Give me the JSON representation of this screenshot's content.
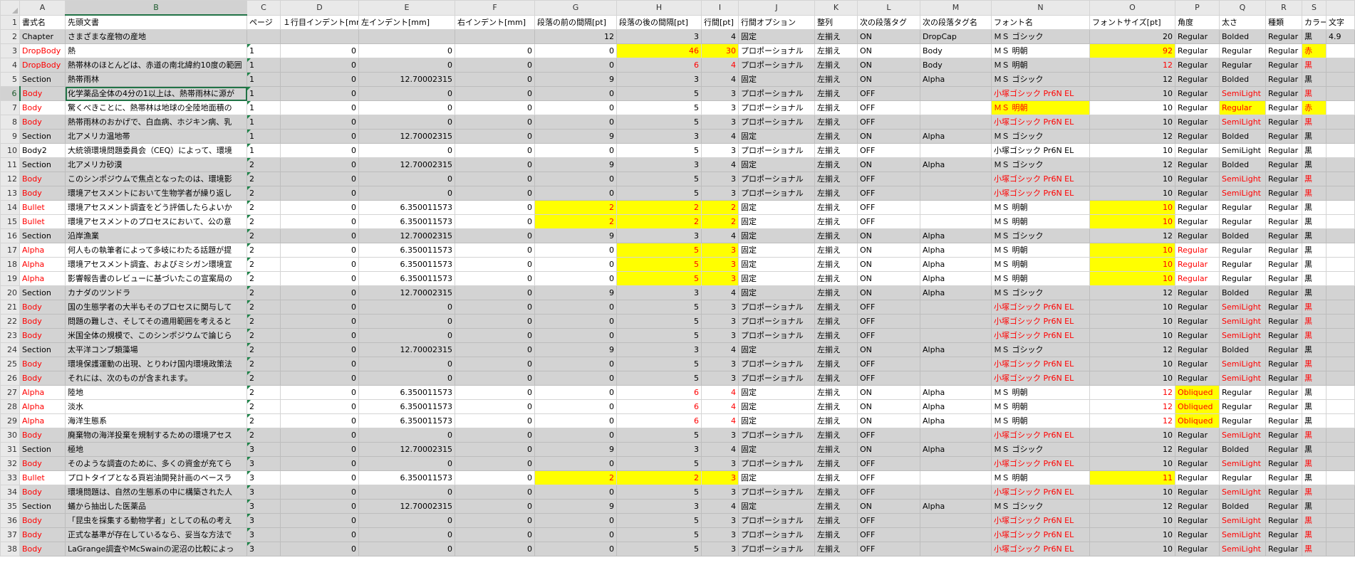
{
  "sheet": {
    "column_letters": [
      "A",
      "B",
      "C",
      "D",
      "E",
      "F",
      "G",
      "H",
      "I",
      "J",
      "K",
      "L",
      "M",
      "N",
      "O",
      "P",
      "Q",
      "R",
      "S",
      ""
    ],
    "selected_column": "B",
    "selected_row": 6,
    "header_row": [
      "書式名",
      "先頭文書",
      "ページ",
      "１行目インデント[mm]",
      "左インデント[mm]",
      "右インデント[mm]",
      "段落の前の間隔[pt]",
      "段落の後の間隔[pt]",
      "行間[pt]",
      "行間オプション",
      "整列",
      "次の段落タグ",
      "次の段落タグ名",
      "フォント名",
      "フォントサイズ[pt]",
      "角度",
      "太さ",
      "種類",
      "カラー",
      "文字"
    ],
    "rows": [
      {
        "num": "2",
        "c": [
          "Chapter",
          "さまざまな産物の産地",
          "",
          "",
          "",
          "",
          "12",
          "3",
          "4",
          "固定",
          "左揃え",
          "ON",
          "DropCap",
          "ＭＳ ゴシック",
          "20",
          "Regular",
          "Bolded",
          "Regular",
          "黒",
          "4.9"
        ]
      },
      {
        "num": "3",
        "c": [
          "DropBody",
          "熱",
          "1",
          "0",
          "0",
          "0",
          "0",
          "46",
          "30",
          "プロポーショナル",
          "左揃え",
          "ON",
          "Body",
          "ＭＳ 明朝",
          "92",
          "Regular",
          "Regular",
          "Regular",
          "赤",
          ""
        ]
      },
      {
        "num": "4",
        "c": [
          "DropBody",
          "熱帯林のほとんどは、赤道の南北緯約10度の範囲",
          "1",
          "0",
          "0",
          "0",
          "0",
          "6",
          "4",
          "プロポーショナル",
          "左揃え",
          "ON",
          "Body",
          "ＭＳ 明朝",
          "12",
          "Regular",
          "Regular",
          "Regular",
          "黒",
          ""
        ]
      },
      {
        "num": "5",
        "c": [
          "Section",
          "熱帯雨林",
          "1",
          "0",
          "12.70002315",
          "0",
          "9",
          "3",
          "4",
          "固定",
          "左揃え",
          "ON",
          "Alpha",
          "ＭＳ ゴシック",
          "12",
          "Regular",
          "Bolded",
          "Regular",
          "黒",
          ""
        ]
      },
      {
        "num": "6",
        "c": [
          "Body",
          "化学薬品全体の4分の1以上は、熱帯雨林に源が",
          "1",
          "0",
          "0",
          "0",
          "0",
          "5",
          "3",
          "プロポーショナル",
          "左揃え",
          "OFF",
          "",
          "小塚ゴシック Pr6N EL",
          "10",
          "Regular",
          "SemiLight",
          "Regular",
          "黒",
          ""
        ]
      },
      {
        "num": "7",
        "c": [
          "Body",
          "驚くべきことに、熱帯林は地球の全陸地面積の",
          "1",
          "0",
          "0",
          "0",
          "0",
          "5",
          "3",
          "プロポーショナル",
          "左揃え",
          "OFF",
          "",
          "ＭＳ 明朝",
          "10",
          "Regular",
          "Regular",
          "Regular",
          "赤",
          ""
        ]
      },
      {
        "num": "8",
        "c": [
          "Body",
          "熱帯雨林のおかげで、白血病、ホジキン病、乳",
          "1",
          "0",
          "0",
          "0",
          "0",
          "5",
          "3",
          "プロポーショナル",
          "左揃え",
          "OFF",
          "",
          "小塚ゴシック Pr6N EL",
          "10",
          "Regular",
          "SemiLight",
          "Regular",
          "黒",
          ""
        ]
      },
      {
        "num": "9",
        "c": [
          "Section",
          "北アメリカ温地帯",
          "1",
          "0",
          "12.70002315",
          "0",
          "9",
          "3",
          "4",
          "固定",
          "左揃え",
          "ON",
          "Alpha",
          "ＭＳ ゴシック",
          "12",
          "Regular",
          "Bolded",
          "Regular",
          "黒",
          ""
        ]
      },
      {
        "num": "10",
        "c": [
          "Body2",
          "大統領環境問題委員会（CEQ）によって、環境",
          "1",
          "0",
          "0",
          "0",
          "0",
          "5",
          "3",
          "プロポーショナル",
          "左揃え",
          "OFF",
          "",
          "小塚ゴシック Pr6N EL",
          "10",
          "Regular",
          "SemiLight",
          "Regular",
          "黒",
          ""
        ]
      },
      {
        "num": "11",
        "c": [
          "Section",
          "北アメリカ砂漠",
          "2",
          "0",
          "12.70002315",
          "0",
          "9",
          "3",
          "4",
          "固定",
          "左揃え",
          "ON",
          "Alpha",
          "ＭＳ ゴシック",
          "12",
          "Regular",
          "Bolded",
          "Regular",
          "黒",
          ""
        ]
      },
      {
        "num": "12",
        "c": [
          "Body",
          "このシンポジウムで焦点となったのは、環境影",
          "2",
          "0",
          "0",
          "0",
          "0",
          "5",
          "3",
          "プロポーショナル",
          "左揃え",
          "OFF",
          "",
          "小塚ゴシック Pr6N EL",
          "10",
          "Regular",
          "SemiLight",
          "Regular",
          "黒",
          ""
        ]
      },
      {
        "num": "13",
        "c": [
          "Body",
          "環境アセスメントにおいて生物学者が繰り返し",
          "2",
          "0",
          "0",
          "0",
          "0",
          "5",
          "3",
          "プロポーショナル",
          "左揃え",
          "OFF",
          "",
          "小塚ゴシック Pr6N EL",
          "10",
          "Regular",
          "SemiLight",
          "Regular",
          "黒",
          ""
        ]
      },
      {
        "num": "14",
        "c": [
          "Bullet",
          "環境アセスメント調査をどう評価したらよいか",
          "2",
          "0",
          "6.350011573",
          "0",
          "2",
          "2",
          "2",
          "固定",
          "左揃え",
          "OFF",
          "",
          "ＭＳ 明朝",
          "10",
          "Regular",
          "Regular",
          "Regular",
          "黒",
          ""
        ]
      },
      {
        "num": "15",
        "c": [
          "Bullet",
          "環境アセスメントのプロセスにおいて、公の意",
          "2",
          "0",
          "6.350011573",
          "0",
          "2",
          "2",
          "2",
          "固定",
          "左揃え",
          "OFF",
          "",
          "ＭＳ 明朝",
          "10",
          "Regular",
          "Regular",
          "Regular",
          "黒",
          ""
        ]
      },
      {
        "num": "16",
        "c": [
          "Section",
          "沿岸漁業",
          "2",
          "0",
          "12.70002315",
          "0",
          "9",
          "3",
          "4",
          "固定",
          "左揃え",
          "ON",
          "Alpha",
          "ＭＳ ゴシック",
          "12",
          "Regular",
          "Bolded",
          "Regular",
          "黒",
          ""
        ]
      },
      {
        "num": "17",
        "c": [
          "Alpha",
          "何人もの執筆者によって多岐にわたる話題が提",
          "2",
          "0",
          "6.350011573",
          "0",
          "0",
          "5",
          "3",
          "固定",
          "左揃え",
          "ON",
          "Alpha",
          "ＭＳ 明朝",
          "10",
          "Regular",
          "Regular",
          "Regular",
          "黒",
          ""
        ]
      },
      {
        "num": "18",
        "c": [
          "Alpha",
          "環境アセスメント調査、およびミシガン環境宣",
          "2",
          "0",
          "6.350011573",
          "0",
          "0",
          "5",
          "3",
          "固定",
          "左揃え",
          "ON",
          "Alpha",
          "ＭＳ 明朝",
          "10",
          "Regular",
          "Regular",
          "Regular",
          "黒",
          ""
        ]
      },
      {
        "num": "19",
        "c": [
          "Alpha",
          "影響報告書のレビューに基づいたこの宣案局の",
          "2",
          "0",
          "6.350011573",
          "0",
          "0",
          "5",
          "3",
          "固定",
          "左揃え",
          "ON",
          "Alpha",
          "ＭＳ 明朝",
          "10",
          "Regular",
          "Regular",
          "Regular",
          "黒",
          ""
        ]
      },
      {
        "num": "20",
        "c": [
          "Section",
          "カナダのツンドラ",
          "2",
          "0",
          "12.70002315",
          "0",
          "9",
          "3",
          "4",
          "固定",
          "左揃え",
          "ON",
          "Alpha",
          "ＭＳ ゴシック",
          "12",
          "Regular",
          "Bolded",
          "Regular",
          "黒",
          ""
        ]
      },
      {
        "num": "21",
        "c": [
          "Body",
          "国の生態学者の大半もそのプロセスに関与して",
          "2",
          "0",
          "0",
          "0",
          "0",
          "5",
          "3",
          "プロポーショナル",
          "左揃え",
          "OFF",
          "",
          "小塚ゴシック Pr6N EL",
          "10",
          "Regular",
          "SemiLight",
          "Regular",
          "黒",
          ""
        ]
      },
      {
        "num": "22",
        "c": [
          "Body",
          "問題の難しさ、そしてその適用範囲を考えると",
          "2",
          "0",
          "0",
          "0",
          "0",
          "5",
          "3",
          "プロポーショナル",
          "左揃え",
          "OFF",
          "",
          "小塚ゴシック Pr6N EL",
          "10",
          "Regular",
          "SemiLight",
          "Regular",
          "黒",
          ""
        ]
      },
      {
        "num": "23",
        "c": [
          "Body",
          "米国全体の規模で、このシンポジウムで論じら",
          "2",
          "0",
          "0",
          "0",
          "0",
          "5",
          "3",
          "プロポーショナル",
          "左揃え",
          "OFF",
          "",
          "小塚ゴシック Pr6N EL",
          "10",
          "Regular",
          "SemiLight",
          "Regular",
          "黒",
          ""
        ]
      },
      {
        "num": "24",
        "c": [
          "Section",
          "太平洋コンブ類藻場",
          "2",
          "0",
          "12.70002315",
          "0",
          "9",
          "3",
          "4",
          "固定",
          "左揃え",
          "ON",
          "Alpha",
          "ＭＳ ゴシック",
          "12",
          "Regular",
          "Bolded",
          "Regular",
          "黒",
          ""
        ]
      },
      {
        "num": "25",
        "c": [
          "Body",
          "環境保護運動の出現、とりわけ国内環境政策法",
          "2",
          "0",
          "0",
          "0",
          "0",
          "5",
          "3",
          "プロポーショナル",
          "左揃え",
          "OFF",
          "",
          "小塚ゴシック Pr6N EL",
          "10",
          "Regular",
          "SemiLight",
          "Regular",
          "黒",
          ""
        ]
      },
      {
        "num": "26",
        "c": [
          "Body",
          "それには、次のものが含まれます。",
          "2",
          "0",
          "0",
          "0",
          "0",
          "5",
          "3",
          "プロポーショナル",
          "左揃え",
          "OFF",
          "",
          "小塚ゴシック Pr6N EL",
          "10",
          "Regular",
          "SemiLight",
          "Regular",
          "黒",
          ""
        ]
      },
      {
        "num": "27",
        "c": [
          "Alpha",
          "陸地",
          "2",
          "0",
          "6.350011573",
          "0",
          "0",
          "6",
          "4",
          "固定",
          "左揃え",
          "ON",
          "Alpha",
          "ＭＳ 明朝",
          "12",
          "Obliqued",
          "Regular",
          "Regular",
          "黒",
          ""
        ]
      },
      {
        "num": "28",
        "c": [
          "Alpha",
          "淡水",
          "2",
          "0",
          "6.350011573",
          "0",
          "0",
          "6",
          "4",
          "固定",
          "左揃え",
          "ON",
          "Alpha",
          "ＭＳ 明朝",
          "12",
          "Obliqued",
          "Regular",
          "Regular",
          "黒",
          ""
        ]
      },
      {
        "num": "29",
        "c": [
          "Alpha",
          "海洋生態系",
          "2",
          "0",
          "6.350011573",
          "0",
          "0",
          "6",
          "4",
          "固定",
          "左揃え",
          "ON",
          "Alpha",
          "ＭＳ 明朝",
          "12",
          "Obliqued",
          "Regular",
          "Regular",
          "黒",
          ""
        ]
      },
      {
        "num": "30",
        "c": [
          "Body",
          "廃棄物の海洋投棄を規制するための環境アセス",
          "2",
          "0",
          "0",
          "0",
          "0",
          "5",
          "3",
          "プロポーショナル",
          "左揃え",
          "OFF",
          "",
          "小塚ゴシック Pr6N EL",
          "10",
          "Regular",
          "SemiLight",
          "Regular",
          "黒",
          ""
        ]
      },
      {
        "num": "31",
        "c": [
          "Section",
          "極地",
          "3",
          "0",
          "12.70002315",
          "0",
          "9",
          "3",
          "4",
          "固定",
          "左揃え",
          "ON",
          "Alpha",
          "ＭＳ ゴシック",
          "12",
          "Regular",
          "Bolded",
          "Regular",
          "黒",
          ""
        ]
      },
      {
        "num": "32",
        "c": [
          "Body",
          "そのような調査のために、多くの資金が充てら",
          "3",
          "0",
          "0",
          "0",
          "0",
          "5",
          "3",
          "プロポーショナル",
          "左揃え",
          "OFF",
          "",
          "小塚ゴシック Pr6N EL",
          "10",
          "Regular",
          "SemiLight",
          "Regular",
          "黒",
          ""
        ]
      },
      {
        "num": "33",
        "c": [
          "Bullet",
          "プロトタイプとなる頁岩油開発計画のベースラ",
          "3",
          "0",
          "6.350011573",
          "0",
          "2",
          "2",
          "3",
          "固定",
          "左揃え",
          "OFF",
          "",
          "ＭＳ 明朝",
          "11",
          "Regular",
          "Regular",
          "Regular",
          "黒",
          ""
        ]
      },
      {
        "num": "34",
        "c": [
          "Body",
          "環境問題は、自然の生態系の中に構築された人",
          "3",
          "0",
          "0",
          "0",
          "0",
          "5",
          "3",
          "プロポーショナル",
          "左揃え",
          "OFF",
          "",
          "小塚ゴシック Pr6N EL",
          "10",
          "Regular",
          "SemiLight",
          "Regular",
          "黒",
          ""
        ]
      },
      {
        "num": "35",
        "c": [
          "Section",
          "蟻から抽出した医薬品",
          "3",
          "0",
          "12.70002315",
          "0",
          "9",
          "3",
          "4",
          "固定",
          "左揃え",
          "ON",
          "Alpha",
          "ＭＳ ゴシック",
          "12",
          "Regular",
          "Bolded",
          "Regular",
          "黒",
          ""
        ]
      },
      {
        "num": "36",
        "c": [
          "Body",
          "「昆虫を採集する動物学者」としての私の考え",
          "3",
          "0",
          "0",
          "0",
          "0",
          "5",
          "3",
          "プロポーショナル",
          "左揃え",
          "OFF",
          "",
          "小塚ゴシック Pr6N EL",
          "10",
          "Regular",
          "SemiLight",
          "Regular",
          "黒",
          ""
        ]
      },
      {
        "num": "37",
        "c": [
          "Body",
          "正式な基準が存在しているなら、妥当な方法で",
          "3",
          "0",
          "0",
          "0",
          "0",
          "5",
          "3",
          "プロポーショナル",
          "左揃え",
          "OFF",
          "",
          "小塚ゴシック Pr6N EL",
          "10",
          "Regular",
          "SemiLight",
          "Regular",
          "黒",
          ""
        ]
      },
      {
        "num": "38",
        "c": [
          "Body",
          "LaGrange調査やMcSwainの泥沼の比較によっ",
          "3",
          "0",
          "0",
          "0",
          "0",
          "5",
          "3",
          "プロポーショナル",
          "左揃え",
          "OFF",
          "",
          "小塚ゴシック Pr6N EL",
          "10",
          "Regular",
          "SemiLight",
          "Regular",
          "黒",
          ""
        ]
      }
    ]
  }
}
